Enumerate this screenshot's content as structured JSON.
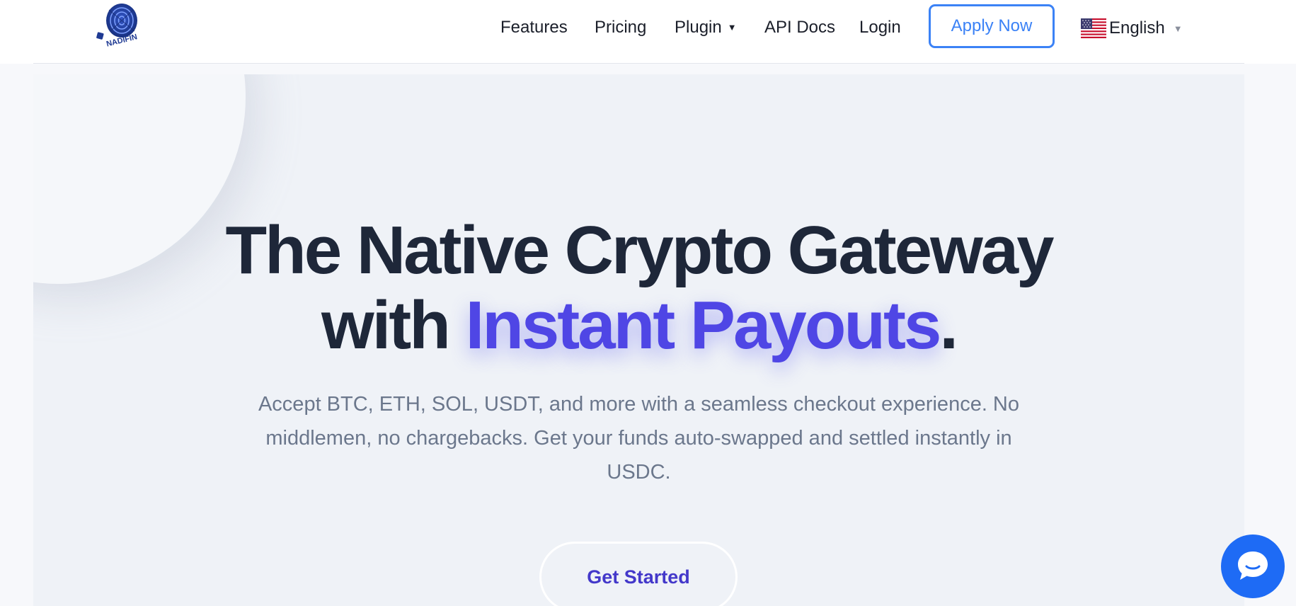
{
  "brand": {
    "logo_text": "NADIFIN",
    "logo_color": "#1f3a93"
  },
  "nav": {
    "items": [
      {
        "label": "Features"
      },
      {
        "label": "Pricing"
      },
      {
        "label": "Plugin",
        "has_dropdown": true
      },
      {
        "label": "API Docs"
      },
      {
        "label": "Login"
      }
    ],
    "apply_button": "Apply Now",
    "language": {
      "label": "English",
      "flag_icon": "us-flag-icon"
    }
  },
  "hero": {
    "headline_line1": "The Native Crypto Gateway",
    "headline_with": "with",
    "headline_accent": "Instant Payouts",
    "headline_period": ".",
    "subtext": "Accept BTC, ETH, SOL, USDT, and more with a seamless checkout experience. No middlemen, no chargebacks. Get your funds auto-swapped and settled instantly in USDC.",
    "cta_label": "Get Started"
  },
  "chat": {
    "icon": "chat-bubble-icon"
  },
  "colors": {
    "accent": "#4f46e5",
    "button_blue": "#3b82f6",
    "chat_blue": "#1e6bf5",
    "heading": "#1e2739",
    "subtext": "#6b778c"
  }
}
